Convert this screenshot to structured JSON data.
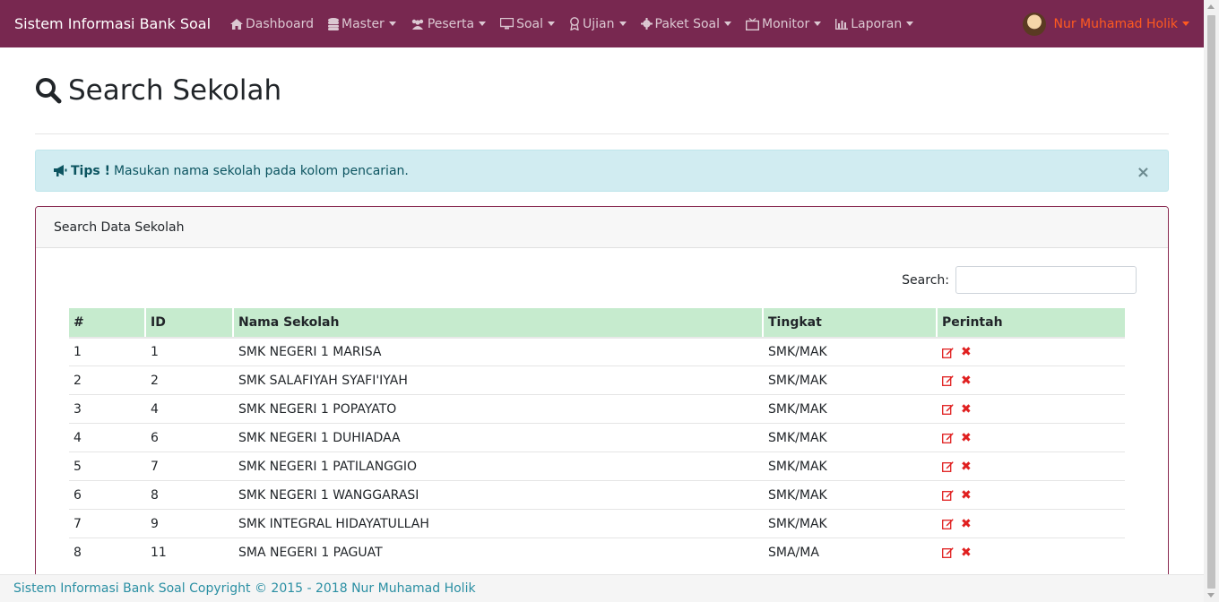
{
  "navbar": {
    "brand": "Sistem Informasi Bank Soal",
    "items": [
      {
        "label": "Dashboard",
        "icon": "home-icon",
        "dropdown": false
      },
      {
        "label": "Master",
        "icon": "database-icon",
        "dropdown": true
      },
      {
        "label": "Peserta",
        "icon": "users-icon",
        "dropdown": true
      },
      {
        "label": "Soal",
        "icon": "monitor-icon",
        "dropdown": true
      },
      {
        "label": "Ujian",
        "icon": "award-icon",
        "dropdown": true
      },
      {
        "label": "Paket Soal",
        "icon": "gear-icon",
        "dropdown": true
      },
      {
        "label": "Monitor",
        "icon": "tv-icon",
        "dropdown": true
      },
      {
        "label": "Laporan",
        "icon": "bar-chart-icon",
        "dropdown": true
      }
    ],
    "user": "Nur Muhamad Holik"
  },
  "page": {
    "title": "Search Sekolah"
  },
  "alert": {
    "label": "Tips !",
    "message": "Masukan nama sekolah pada kolom pencarian.",
    "close": "×"
  },
  "panel": {
    "title": "Search Data Sekolah",
    "search_label": "Search:",
    "search_value": ""
  },
  "table": {
    "headers": [
      "#",
      "ID",
      "Nama Sekolah",
      "Tingkat",
      "Perintah"
    ],
    "rows": [
      {
        "no": "1",
        "id": "1",
        "nama": "SMK NEGERI 1 MARISA",
        "tingkat": "SMK/MAK"
      },
      {
        "no": "2",
        "id": "2",
        "nama": "SMK SALAFIYAH SYAFI'IYAH",
        "tingkat": "SMK/MAK"
      },
      {
        "no": "3",
        "id": "4",
        "nama": "SMK NEGERI 1 POPAYATO",
        "tingkat": "SMK/MAK"
      },
      {
        "no": "4",
        "id": "6",
        "nama": "SMK NEGERI 1 DUHIADAA",
        "tingkat": "SMK/MAK"
      },
      {
        "no": "5",
        "id": "7",
        "nama": "SMK NEGERI 1 PATILANGGIO",
        "tingkat": "SMK/MAK"
      },
      {
        "no": "6",
        "id": "8",
        "nama": "SMK NEGERI 1 WANGGARASI",
        "tingkat": "SMK/MAK"
      },
      {
        "no": "7",
        "id": "9",
        "nama": "SMK INTEGRAL HIDAYATULLAH",
        "tingkat": "SMK/MAK"
      },
      {
        "no": "8",
        "id": "11",
        "nama": "SMA NEGERI 1 PAGUAT",
        "tingkat": "SMA/MA"
      }
    ]
  },
  "footer": {
    "text": "Sistem Informasi Bank Soal Copyright © 2015 - 2018 Nur Muhamad Holik"
  },
  "colors": {
    "navbar": "#782850",
    "user": "#ff5a1f",
    "table_header": "#c6ebce",
    "alert_bg": "#d1ecf1",
    "delete": "#e02020"
  }
}
